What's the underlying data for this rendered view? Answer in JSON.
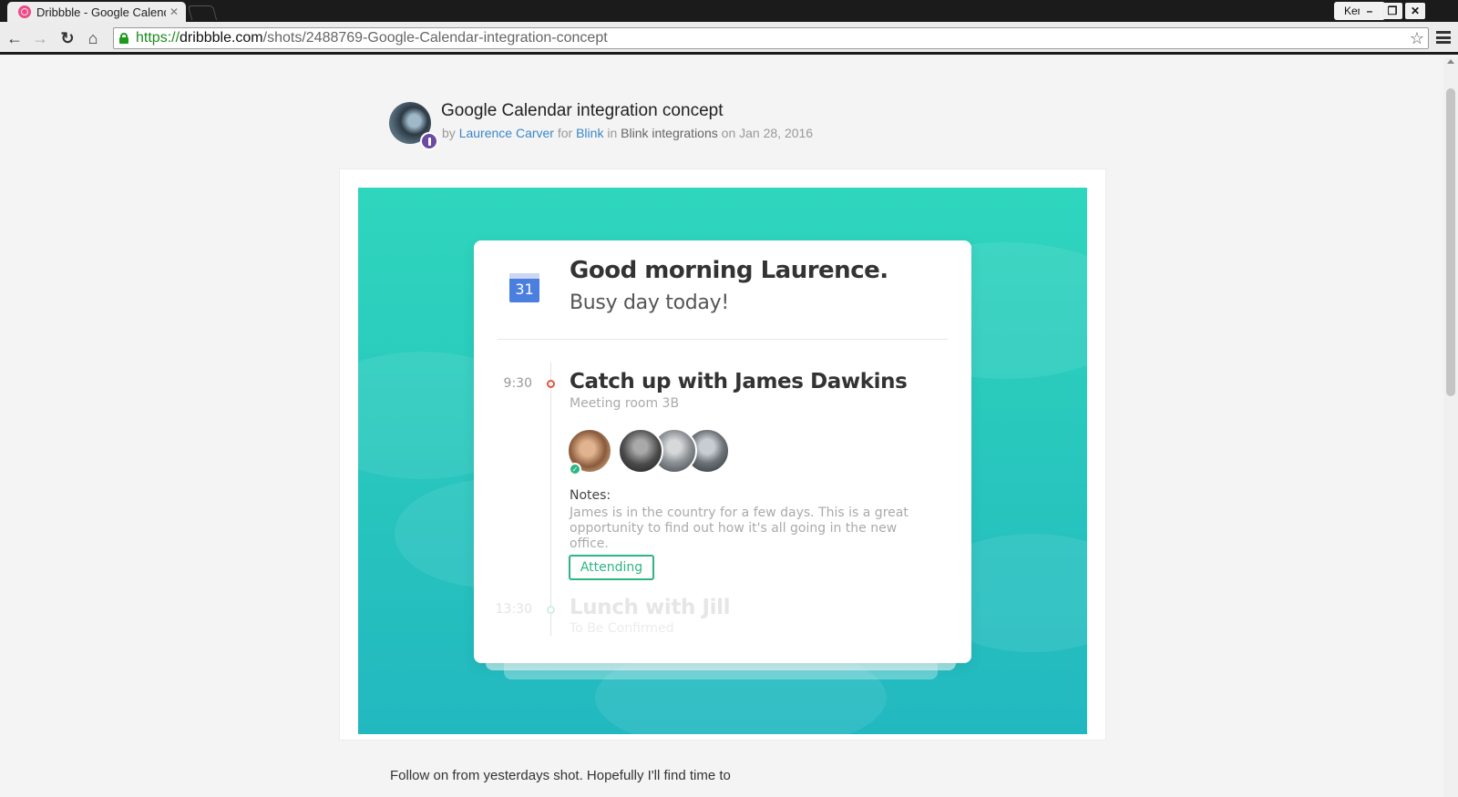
{
  "browser": {
    "tab_title": "Dribbble - Google Calendar integration concept",
    "profile_name": "Kenny",
    "url_scheme": "https://",
    "url_host": "dribbble.com",
    "url_path": "/shots/2488769-Google-Calendar-integration-concept"
  },
  "shot": {
    "title": "Google Calendar integration concept",
    "meta": {
      "by_word": "by",
      "author": "Laurence Carver",
      "for_word": "for",
      "team": "Blink",
      "in_word": "in",
      "project": "Blink integrations",
      "on_word": "on",
      "date": "Jan 28, 2016"
    },
    "description": "Follow on from yesterdays shot. Hopefully I'll find time to"
  },
  "calendar_card": {
    "icon_day": "31",
    "greeting": "Good morning Laurence.",
    "subgreeting": "Busy day today!",
    "events": [
      {
        "time": "9:30",
        "title": "Catch up with James Dawkins",
        "location": "Meeting room 3B",
        "notes_label": "Notes:",
        "notes": "James is in the country for a few days. This is a great opportunity to find out how it's all going in the new office.",
        "status_button": "Attending"
      },
      {
        "time": "13:30",
        "title": "Lunch with Jill",
        "location": "To Be Confirmed"
      }
    ]
  },
  "colors": {
    "accent_green": "#2cb682",
    "link_blue": "#3a87c8",
    "hero_teal": "#29c8bd",
    "event_dot_red": "#e5533d"
  }
}
